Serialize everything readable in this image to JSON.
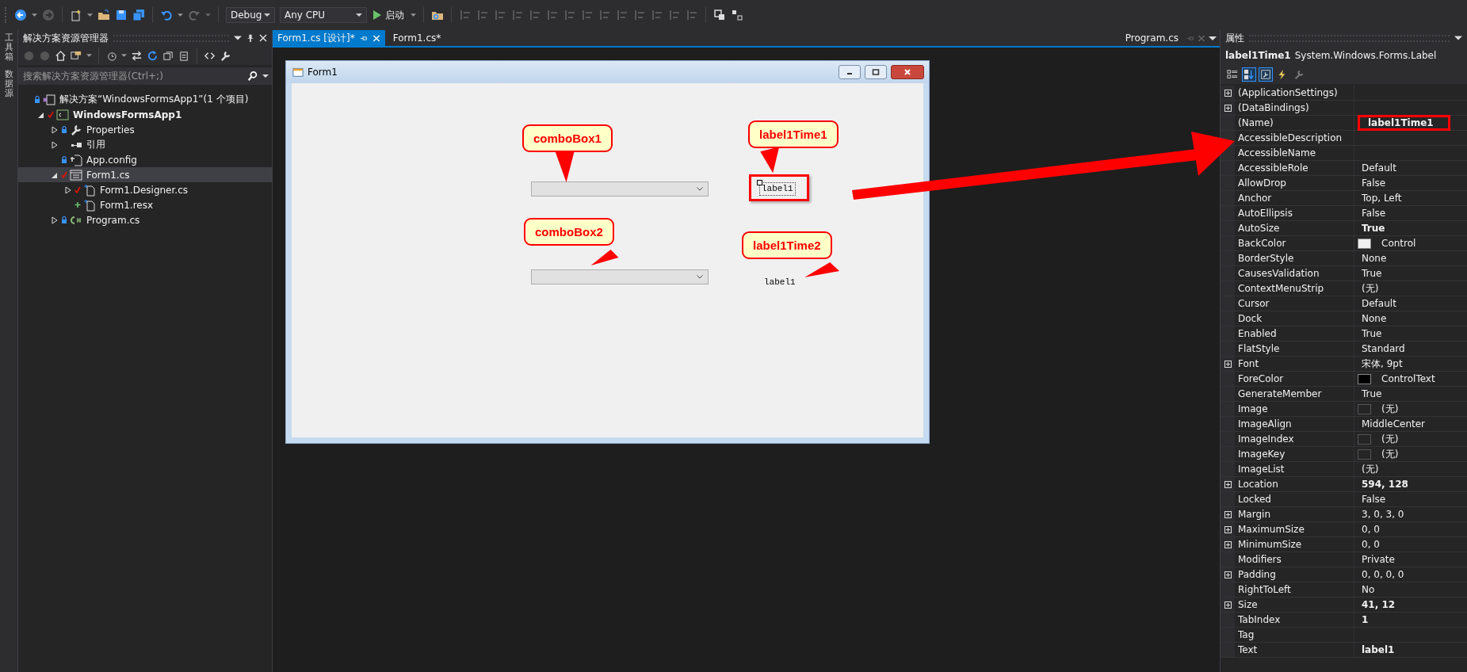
{
  "toolbar": {
    "configuration": "Debug",
    "platform": "Any CPU",
    "start_label": "启动"
  },
  "side_strip": [
    "工具箱",
    "数据源"
  ],
  "solution_explorer": {
    "title": "解决方案资源管理器",
    "search": {
      "placeholder": "搜索解决方案资源管理器(Ctrl+;)"
    },
    "tree": [
      {
        "label": "解决方案“WindowsFormsApp1”(1 个项目)",
        "kind": "solution",
        "locked": true,
        "modified": false,
        "added": false,
        "selected": false,
        "bold": false,
        "children": [
          {
            "label": "WindowsFormsApp1",
            "kind": "csproj",
            "locked": false,
            "modified": true,
            "added": false,
            "expanded": true,
            "selected": false,
            "bold": true,
            "children": [
              {
                "label": "Properties",
                "kind": "properties",
                "locked": true,
                "modified": false,
                "added": false,
                "expanded": false,
                "selected": false,
                "bold": false
              },
              {
                "label": "引用",
                "kind": "references",
                "locked": false,
                "modified": false,
                "added": false,
                "expanded": false,
                "selected": false,
                "bold": false
              },
              {
                "label": "App.config",
                "kind": "config",
                "locked": true,
                "modified": false,
                "added": false,
                "selected": false,
                "bold": false
              },
              {
                "label": "Form1.cs",
                "kind": "form",
                "locked": false,
                "modified": true,
                "added": false,
                "expanded": true,
                "selected": true,
                "bold": false,
                "children": [
                  {
                    "label": "Form1.Designer.cs",
                    "kind": "code",
                    "locked": false,
                    "modified": true,
                    "added": false,
                    "expanded": false,
                    "selected": false,
                    "bold": false
                  },
                  {
                    "label": "Form1.resx",
                    "kind": "code",
                    "locked": false,
                    "modified": false,
                    "added": true,
                    "selected": false,
                    "bold": false
                  }
                ]
              },
              {
                "label": "Program.cs",
                "kind": "csfile",
                "locked": true,
                "modified": false,
                "added": false,
                "expanded": false,
                "selected": false,
                "bold": false
              }
            ]
          }
        ]
      }
    ]
  },
  "editor": {
    "tabs": [
      {
        "label": "Form1.cs [设计]*",
        "selected": true
      },
      {
        "label": "Form1.cs*",
        "selected": false
      }
    ],
    "right_tab": "Program.cs",
    "form": {
      "title": "Form1",
      "controls": [
        {
          "kind": "combo",
          "highlighted": false,
          "selected": false
        },
        {
          "kind": "label",
          "text": "label1",
          "highlighted": true,
          "selected": true
        },
        {
          "kind": "combo",
          "highlighted": false,
          "selected": false
        },
        {
          "kind": "label",
          "text": "label1",
          "highlighted": false,
          "selected": false
        }
      ],
      "callouts": [
        "comboBox1",
        "label1Time1",
        "comboBox2",
        "label1Time2"
      ]
    }
  },
  "properties": {
    "title": "属性",
    "object_name": "label1Time1",
    "object_type": "System.Windows.Forms.Label",
    "view_buttons": [
      {
        "kind": "categorized",
        "selected": false
      },
      {
        "kind": "alphabetical",
        "selected": true
      },
      {
        "kind": "properties",
        "selected": true
      },
      {
        "kind": "events",
        "selected": false
      },
      {
        "kind": "pages",
        "selected": false
      }
    ],
    "rows": [
      {
        "name": "(ApplicationSettings)",
        "expandable": true
      },
      {
        "name": "(DataBindings)",
        "expandable": true
      },
      {
        "name": "(Name)",
        "value": "label1Time1",
        "expandable": false,
        "bold": true,
        "highlighted": true
      },
      {
        "name": "AccessibleDescription",
        "expandable": false
      },
      {
        "name": "AccessibleName",
        "expandable": false
      },
      {
        "name": "AccessibleRole",
        "value": "Default",
        "expandable": false,
        "bold": false,
        "highlighted": false
      },
      {
        "name": "AllowDrop",
        "value": "False",
        "expandable": false,
        "bold": false,
        "highlighted": false
      },
      {
        "name": "Anchor",
        "value": "Top, Left",
        "expandable": false,
        "bold": false,
        "highlighted": false
      },
      {
        "name": "AutoEllipsis",
        "value": "False",
        "expandable": false,
        "bold": false,
        "highlighted": false
      },
      {
        "name": "AutoSize",
        "value": "True",
        "expandable": false,
        "bold": true,
        "highlighted": false
      },
      {
        "name": "BackColor",
        "value": "Control",
        "expandable": false,
        "bold": false,
        "highlighted": false,
        "swatch": true,
        "color": "#f0f0f0"
      },
      {
        "name": "BorderStyle",
        "value": "None",
        "expandable": false,
        "bold": false,
        "highlighted": false
      },
      {
        "name": "CausesValidation",
        "value": "True",
        "expandable": false,
        "bold": false,
        "highlighted": false
      },
      {
        "name": "ContextMenuStrip",
        "value": "(无)",
        "expandable": false,
        "bold": false,
        "highlighted": false
      },
      {
        "name": "Cursor",
        "value": "Default",
        "expandable": false,
        "bold": false,
        "highlighted": false
      },
      {
        "name": "Dock",
        "value": "None",
        "expandable": false,
        "bold": false,
        "highlighted": false
      },
      {
        "name": "Enabled",
        "value": "True",
        "expandable": false,
        "bold": false,
        "highlighted": false
      },
      {
        "name": "FlatStyle",
        "value": "Standard",
        "expandable": false,
        "bold": false,
        "highlighted": false
      },
      {
        "name": "Font",
        "value": "宋体, 9pt",
        "expandable": true,
        "bold": false,
        "highlighted": false
      },
      {
        "name": "ForeColor",
        "value": "ControlText",
        "expandable": false,
        "bold": false,
        "highlighted": false,
        "swatch": true,
        "color": "#000000"
      },
      {
        "name": "GenerateMember",
        "value": "True",
        "expandable": false,
        "bold": false,
        "highlighted": false
      },
      {
        "name": "Image",
        "value": "(无)",
        "expandable": false,
        "bold": false,
        "highlighted": false,
        "swatch": true
      },
      {
        "name": "ImageAlign",
        "value": "MiddleCenter",
        "expandable": false,
        "bold": false,
        "highlighted": false
      },
      {
        "name": "ImageIndex",
        "value": "(无)",
        "expandable": false,
        "bold": false,
        "highlighted": false,
        "swatch": true
      },
      {
        "name": "ImageKey",
        "value": "(无)",
        "expandable": false,
        "bold": false,
        "highlighted": false,
        "swatch": true
      },
      {
        "name": "ImageList",
        "value": "(无)",
        "expandable": false,
        "bold": false,
        "highlighted": false
      },
      {
        "name": "Location",
        "value": "594, 128",
        "expandable": true,
        "bold": true,
        "highlighted": false
      },
      {
        "name": "Locked",
        "value": "False",
        "expandable": false,
        "bold": false,
        "highlighted": false
      },
      {
        "name": "Margin",
        "value": "3, 0, 3, 0",
        "expandable": true,
        "bold": false,
        "highlighted": false
      },
      {
        "name": "MaximumSize",
        "value": "0, 0",
        "expandable": true,
        "bold": false,
        "highlighted": false
      },
      {
        "name": "MinimumSize",
        "value": "0, 0",
        "expandable": true,
        "bold": false,
        "highlighted": false
      },
      {
        "name": "Modifiers",
        "value": "Private",
        "expandable": false,
        "bold": false,
        "highlighted": false
      },
      {
        "name": "Padding",
        "value": "0, 0, 0, 0",
        "expandable": true,
        "bold": false,
        "highlighted": false
      },
      {
        "name": "RightToLeft",
        "value": "No",
        "expandable": false,
        "bold": false,
        "highlighted": false
      },
      {
        "name": "Size",
        "value": "41, 12",
        "expandable": true,
        "bold": true,
        "highlighted": false
      },
      {
        "name": "TabIndex",
        "value": "1",
        "expandable": false,
        "bold": true,
        "highlighted": false
      },
      {
        "name": "Tag",
        "expandable": false
      },
      {
        "name": "Text",
        "value": "label1",
        "expandable": false,
        "bold": true,
        "highlighted": false
      }
    ]
  }
}
